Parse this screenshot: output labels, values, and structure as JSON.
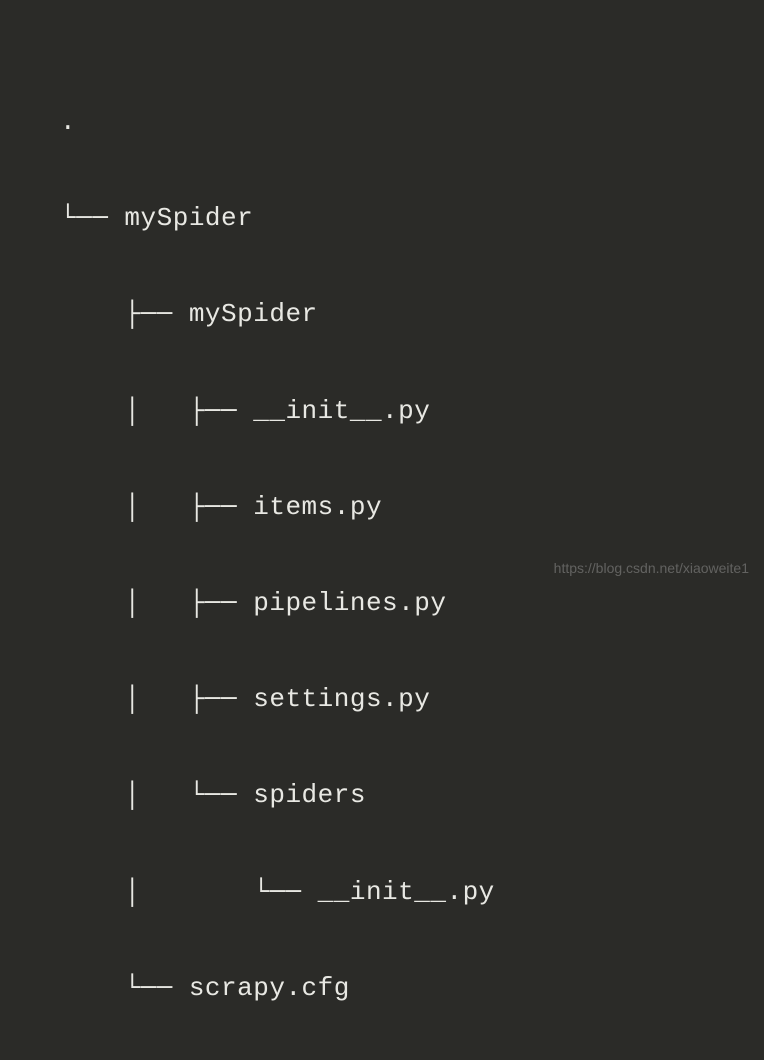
{
  "tree": {
    "root": ".",
    "nodes": [
      {
        "prefix": "└── ",
        "name": "mySpider"
      },
      {
        "prefix": "    ├── ",
        "name": "mySpider"
      },
      {
        "prefix": "    │   ├── ",
        "name": "__init__.py"
      },
      {
        "prefix": "    │   ├── ",
        "name": "items.py"
      },
      {
        "prefix": "    │   ├── ",
        "name": "pipelines.py"
      },
      {
        "prefix": "    │   ├── ",
        "name": "settings.py"
      },
      {
        "prefix": "    │   └── ",
        "name": "spiders"
      },
      {
        "prefix": "    │       └── ",
        "name": "__init__.py"
      },
      {
        "prefix": "    └── ",
        "name": "scrapy.cfg"
      }
    ]
  },
  "watermark": "https://blog.csdn.net/xiaoweite1"
}
